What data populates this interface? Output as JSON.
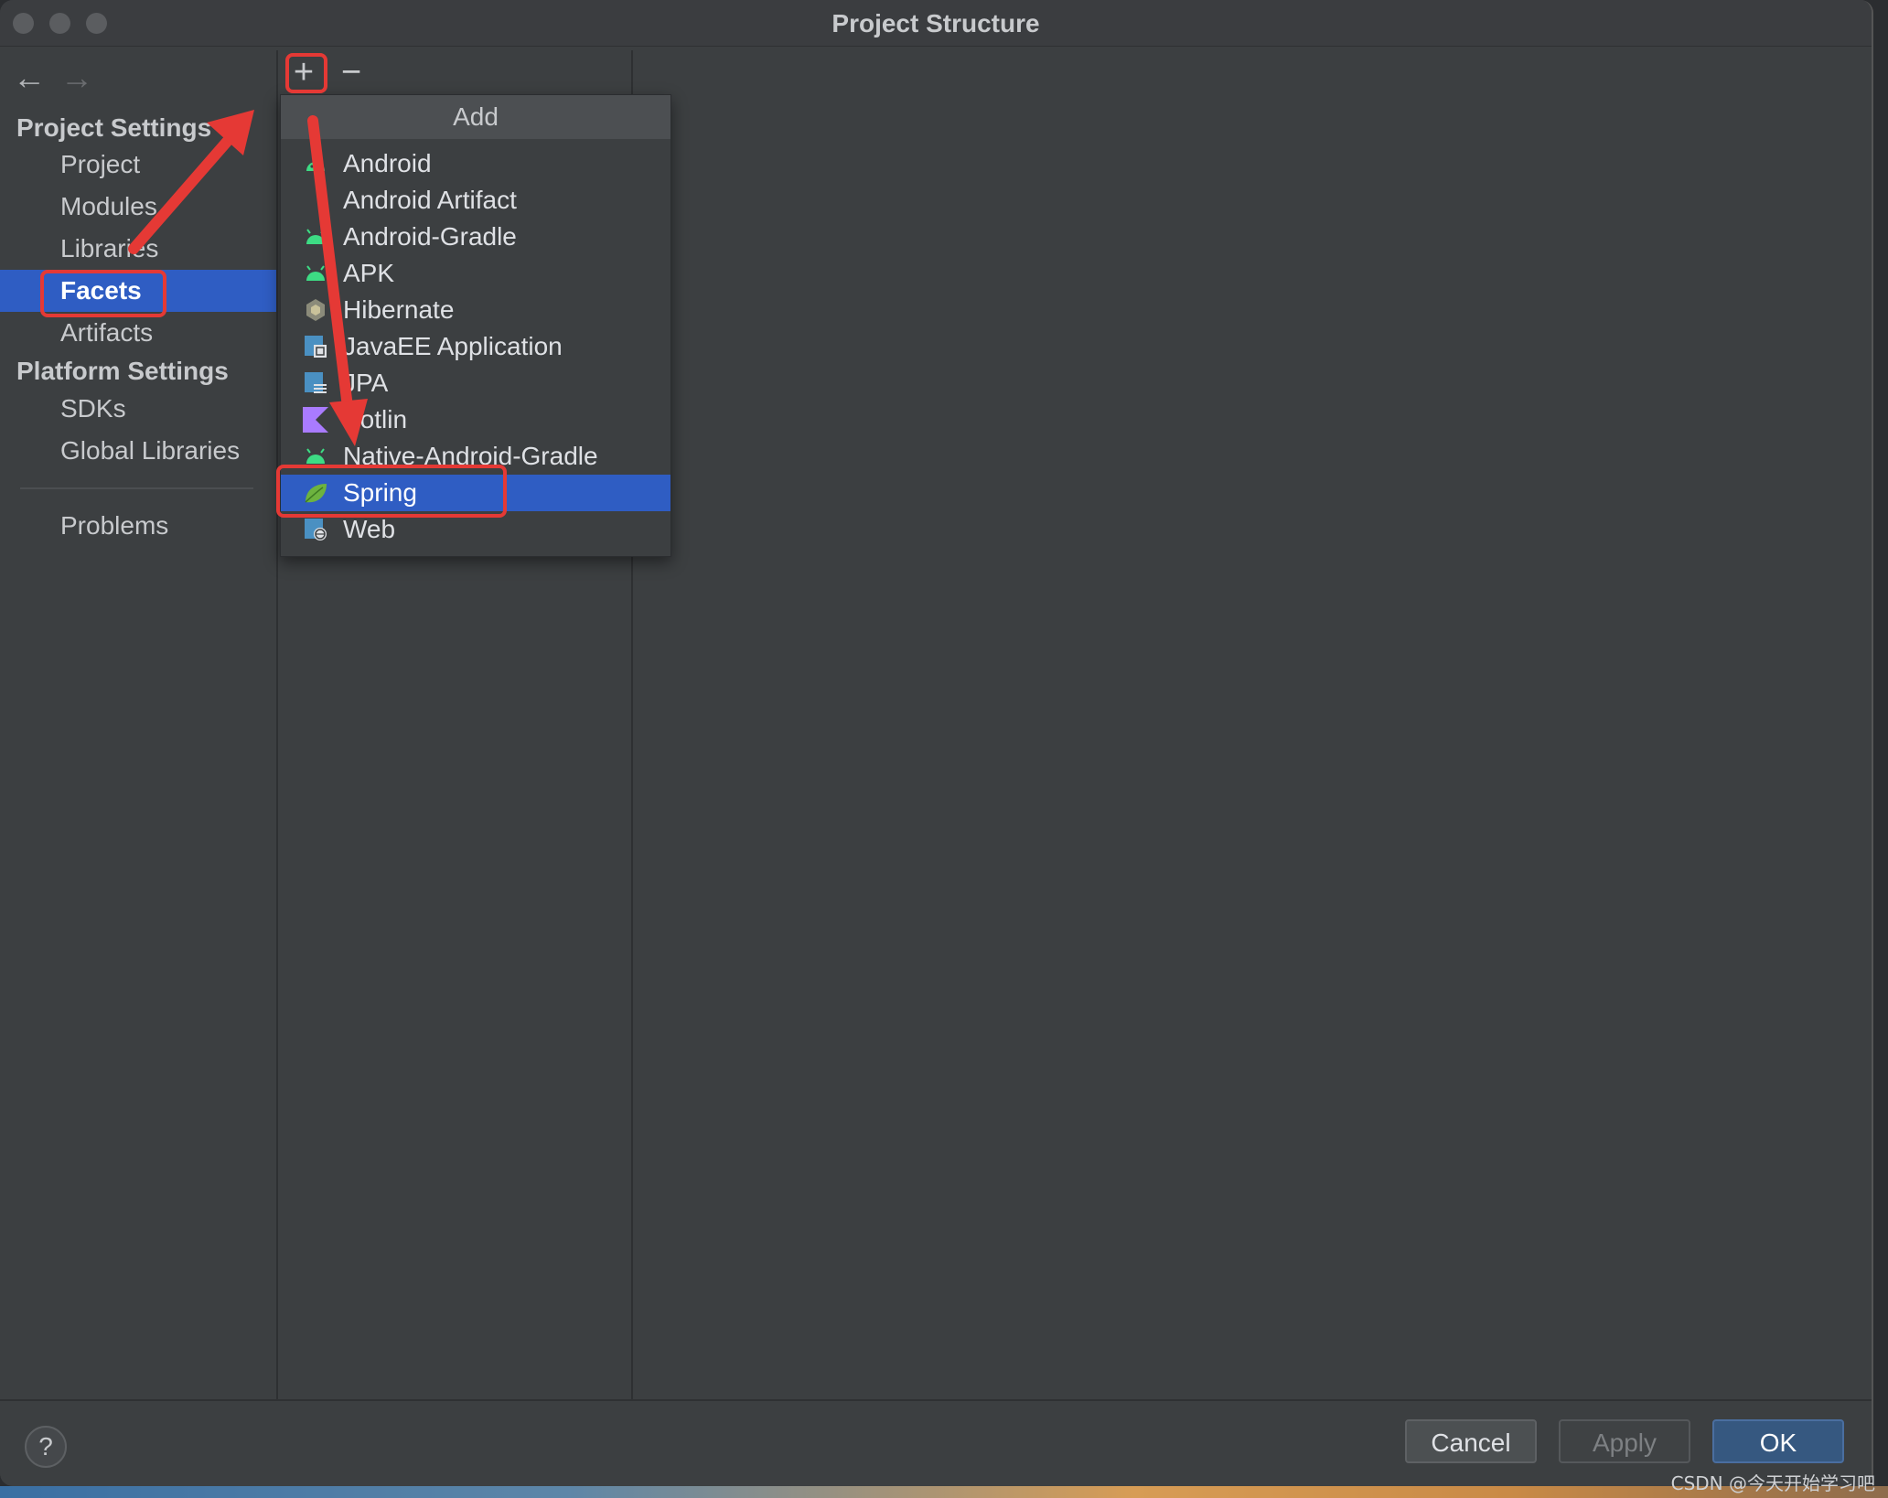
{
  "window": {
    "title": "Project Structure"
  },
  "sidebar": {
    "back_icon": "arrow-left-icon",
    "forward_icon": "arrow-right-icon",
    "project_settings": {
      "header": "Project Settings",
      "items": [
        "Project",
        "Modules",
        "Libraries",
        "Facets",
        "Artifacts"
      ]
    },
    "platform_settings": {
      "header": "Platform Settings",
      "items": [
        "SDKs",
        "Global Libraries"
      ]
    },
    "problems": "Problems",
    "selected": "Facets"
  },
  "toolbar": {
    "add_icon": "plus-icon",
    "remove_icon": "minus-icon",
    "add_symbol": "+",
    "remove_symbol": "−"
  },
  "add_popup": {
    "title": "Add",
    "items": [
      {
        "label": "Android",
        "icon": "android-icon"
      },
      {
        "label": "Android Artifact",
        "icon": "android-icon"
      },
      {
        "label": "Android-Gradle",
        "icon": "android-icon"
      },
      {
        "label": "APK",
        "icon": "android-icon"
      },
      {
        "label": "Hibernate",
        "icon": "hibernate-icon"
      },
      {
        "label": "JavaEE Application",
        "icon": "javaee-icon"
      },
      {
        "label": "JPA",
        "icon": "jpa-icon"
      },
      {
        "label": "Kotlin",
        "icon": "kotlin-icon"
      },
      {
        "label": "Native-Android-Gradle",
        "icon": "android-icon"
      },
      {
        "label": "Spring",
        "icon": "spring-leaf-icon"
      },
      {
        "label": "Web",
        "icon": "web-icon"
      }
    ],
    "selected": "Spring"
  },
  "footer": {
    "help_label": "?",
    "cancel_label": "Cancel",
    "apply_label": "Apply",
    "ok_label": "OK"
  },
  "watermark": "CSDN @今天开始学习吧",
  "colors": {
    "selection": "#2f5dc3",
    "annotation_red": "#e53935",
    "android_green": "#3ddc84",
    "kotlin_purple": "#a97bff",
    "spring_green": "#6db33f"
  }
}
